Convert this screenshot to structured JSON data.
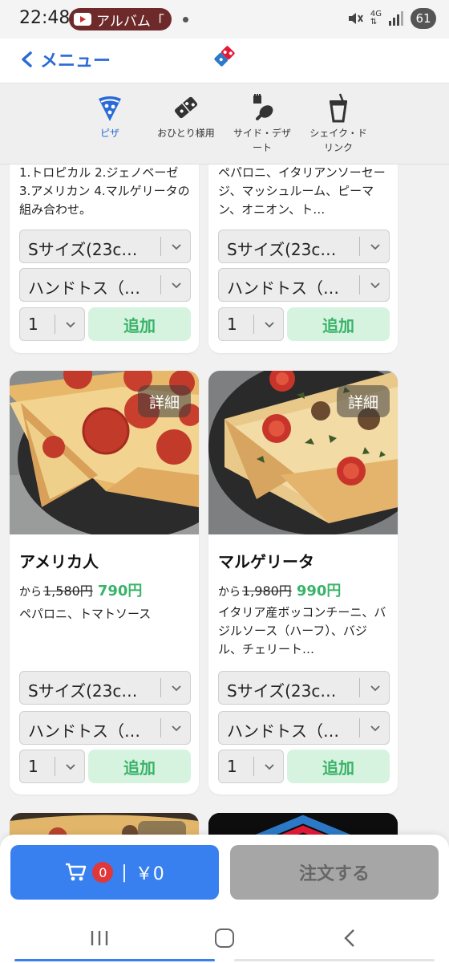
{
  "status_bar": {
    "time": "22:48",
    "notification": "アルバム「",
    "battery": "61",
    "network": "4G"
  },
  "header": {
    "back_label": "メニュー"
  },
  "categories": [
    {
      "label": "ピザ",
      "icon": "pizza-slice-icon",
      "active": true
    },
    {
      "label": "おひとり様用",
      "icon": "domino-logo-icon",
      "active": false
    },
    {
      "label": "サイド・デザート",
      "label_lines": [
        "サイド・デザ",
        "ート"
      ],
      "icon": "chicken-icon",
      "active": false
    },
    {
      "label": "シェイク・ドリンク",
      "label_lines": [
        "シェイク・ド",
        "リンク"
      ],
      "icon": "drink-cup-icon",
      "active": false
    }
  ],
  "products_top": [
    {
      "description": "1.トロピカル 2.ジェノベーゼ 3.アメリカン 4.マルゲリータの組み合わせ。",
      "size": "Sサイズ(23c…",
      "crust": "ハンドトス（…",
      "qty": "1",
      "add_label": "追加"
    },
    {
      "description": "ペパロニ、イタリアンソーセージ、マッシュルーム、ピーマン、オニオン、ト…",
      "size": "Sサイズ(23c…",
      "crust": "ハンドトス（…",
      "qty": "1",
      "add_label": "追加"
    }
  ],
  "products": [
    {
      "name": "アメリカ人",
      "price_prefix": "から",
      "old_price": "1,580円",
      "new_price": "790円",
      "description": "ペパロニ、トマトソース",
      "detail_label": "詳細",
      "size": "Sサイズ(23c…",
      "crust": "ハンドトス（…",
      "qty": "1",
      "add_label": "追加"
    },
    {
      "name": "マルゲリータ",
      "price_prefix": "から",
      "old_price": "1,980円",
      "new_price": "990円",
      "description": "イタリア産ボッコンチーニ、バジルソース（ハーフ）、バジル、チェリート…",
      "detail_label": "詳細",
      "size": "Sサイズ(23c…",
      "crust": "ハンドトス（…",
      "qty": "1",
      "add_label": "追加"
    }
  ],
  "cart": {
    "count": "0",
    "total": "￥0"
  },
  "order_button": "注文する",
  "colors": {
    "accent_blue": "#3880ef",
    "price_green": "#3ab36a",
    "add_bg": "#d6f3df",
    "badge_red": "#e0373a",
    "disabled_gray": "#a6a6a6"
  }
}
